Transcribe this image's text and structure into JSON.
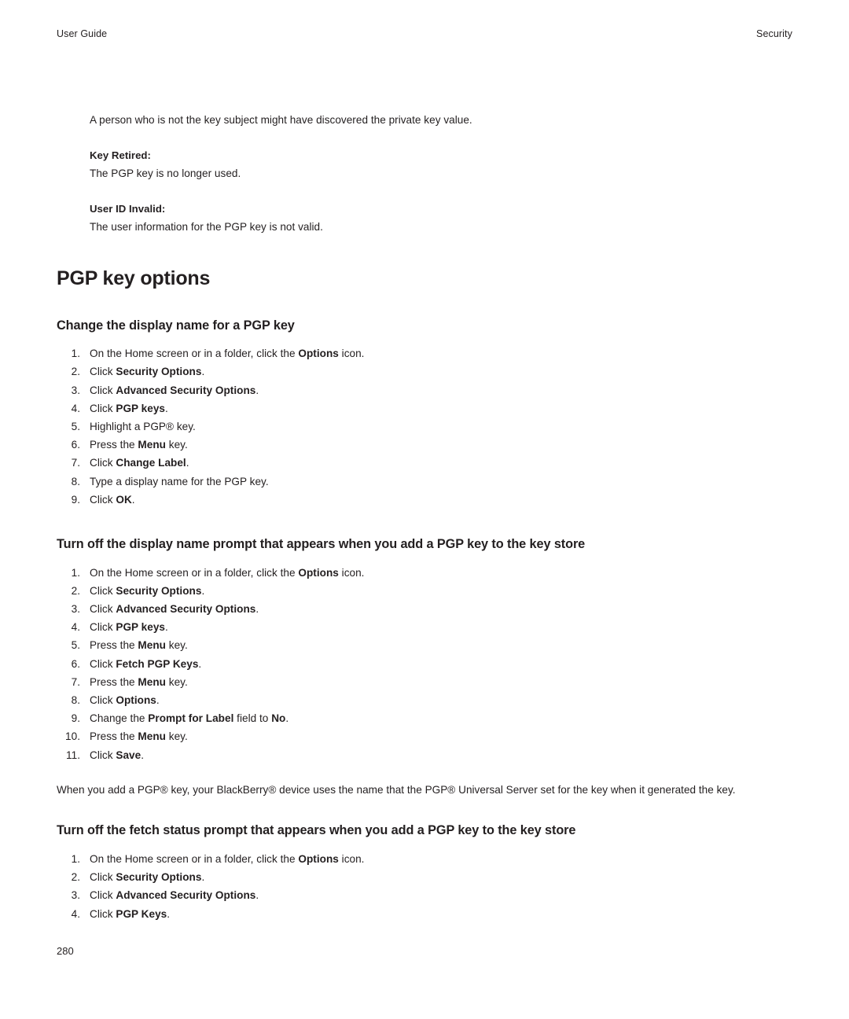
{
  "header": {
    "left": "User Guide",
    "right": "Security"
  },
  "intro": "A person who is not the key subject might have discovered the private key value.",
  "definitions": [
    {
      "term": "Key Retired:",
      "desc": "The PGP key is no longer used."
    },
    {
      "term": "User ID Invalid:",
      "desc": "The user information for the PGP key is not valid."
    }
  ],
  "chapter_title": "PGP key options",
  "sections": [
    {
      "heading": "Change the display name for a PGP key",
      "steps": [
        {
          "num": "1.",
          "html": "On the Home screen or in a folder, click the <b>Options</b> icon."
        },
        {
          "num": "2.",
          "html": "Click <b>Security Options</b>."
        },
        {
          "num": "3.",
          "html": "Click <b>Advanced Security Options</b>."
        },
        {
          "num": "4.",
          "html": "Click <b>PGP keys</b>."
        },
        {
          "num": "5.",
          "html": "Highlight a PGP&#174; key."
        },
        {
          "num": "6.",
          "html": "Press the <b>Menu</b> key."
        },
        {
          "num": "7.",
          "html": "Click <b>Change Label</b>."
        },
        {
          "num": "8.",
          "html": "Type a display name for the PGP key."
        },
        {
          "num": "9.",
          "html": "Click <b>OK</b>."
        }
      ],
      "note": ""
    },
    {
      "heading": "Turn off the display name prompt that appears when you add a PGP key to the key store",
      "steps": [
        {
          "num": "1.",
          "html": "On the Home screen or in a folder, click the <b>Options</b> icon."
        },
        {
          "num": "2.",
          "html": "Click <b>Security Options</b>."
        },
        {
          "num": "3.",
          "html": "Click <b>Advanced Security Options</b>."
        },
        {
          "num": "4.",
          "html": "Click <b>PGP keys</b>."
        },
        {
          "num": "5.",
          "html": "Press the <b>Menu</b> key."
        },
        {
          "num": "6.",
          "html": "Click <b>Fetch PGP Keys</b>."
        },
        {
          "num": "7.",
          "html": "Press the <b>Menu</b> key."
        },
        {
          "num": "8.",
          "html": "Click <b>Options</b>."
        },
        {
          "num": "9.",
          "html": "Change the <b>Prompt for Label</b> field to <b>No</b>."
        },
        {
          "num": "10.",
          "html": "Press the <b>Menu</b> key."
        },
        {
          "num": "11.",
          "html": "Click <b>Save</b>."
        }
      ],
      "note": "When you add a PGP&#174; key, your BlackBerry&#174; device uses the name that the PGP&#174; Universal Server set for the key when it generated the key."
    },
    {
      "heading": "Turn off the fetch status prompt that appears when you add a PGP key to the key store",
      "steps": [
        {
          "num": "1.",
          "html": "On the Home screen or in a folder, click the <b>Options</b> icon."
        },
        {
          "num": "2.",
          "html": "Click <b>Security Options</b>."
        },
        {
          "num": "3.",
          "html": "Click <b>Advanced Security Options</b>."
        },
        {
          "num": "4.",
          "html": "Click <b>PGP Keys</b>."
        }
      ],
      "note": ""
    }
  ],
  "page_number": "280"
}
